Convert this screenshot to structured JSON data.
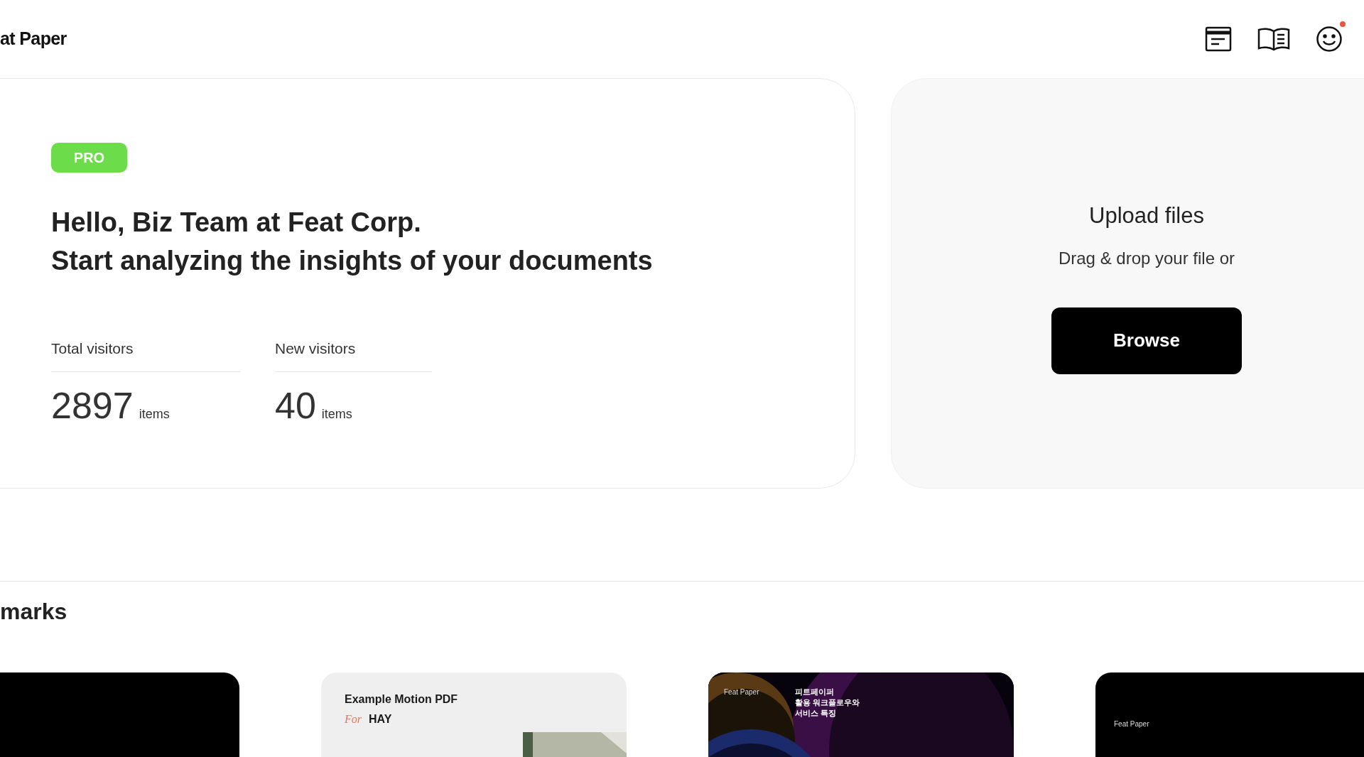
{
  "header": {
    "logo": "at Paper",
    "notification": true
  },
  "hero": {
    "badge": "PRO",
    "greeting": "Hello, Biz Team at Feat Corp.",
    "subtitle": "Start analyzing the insights of your documents",
    "stats": [
      {
        "label": "Total visitors",
        "value": "2897",
        "unit": "items"
      },
      {
        "label": "New visitors",
        "value": "40",
        "unit": "items"
      }
    ]
  },
  "upload": {
    "title": "Upload files",
    "subtitle": "Drag & drop your file or",
    "button": "Browse"
  },
  "section": {
    "title": "marks"
  },
  "documents": [
    {
      "kind": "blank"
    },
    {
      "kind": "light",
      "title": "Example Motion PDF",
      "for_label": "For",
      "client": "HAY"
    },
    {
      "kind": "space",
      "brand": "Feat Paper",
      "title_lines": [
        "피트페이퍼",
        "활용 워크플로우와",
        "서비스 특징"
      ]
    },
    {
      "kind": "dark",
      "brand": "Feat Paper"
    }
  ]
}
